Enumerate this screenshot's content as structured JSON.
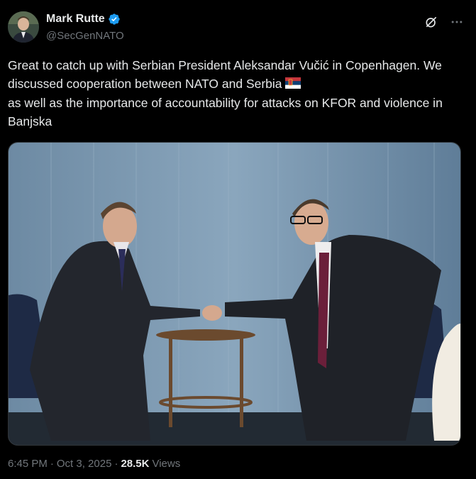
{
  "author": {
    "name": "Mark Rutte",
    "handle": "@SecGenNATO",
    "verified": true,
    "verified_color": "#1d9bf0"
  },
  "actions": {
    "grok_icon": "grok-icon",
    "more_icon": "more-icon"
  },
  "tweet": {
    "text": "Great to catch up with Serbian President Aleksandar Vučić in Copenhagen. We discussed cooperation between NATO and Serbia",
    "text_after_flag": "as well as the importance of accountability for attacks on KFOR and violence in Banjska",
    "flag": "serbia-flag-icon"
  },
  "media": {
    "type": "photo"
  },
  "meta": {
    "time": "6:45 PM",
    "sep1": "·",
    "date": "Oct 3, 2025",
    "sep2": "·",
    "views_count": "28.5K",
    "views_label": "Views"
  }
}
